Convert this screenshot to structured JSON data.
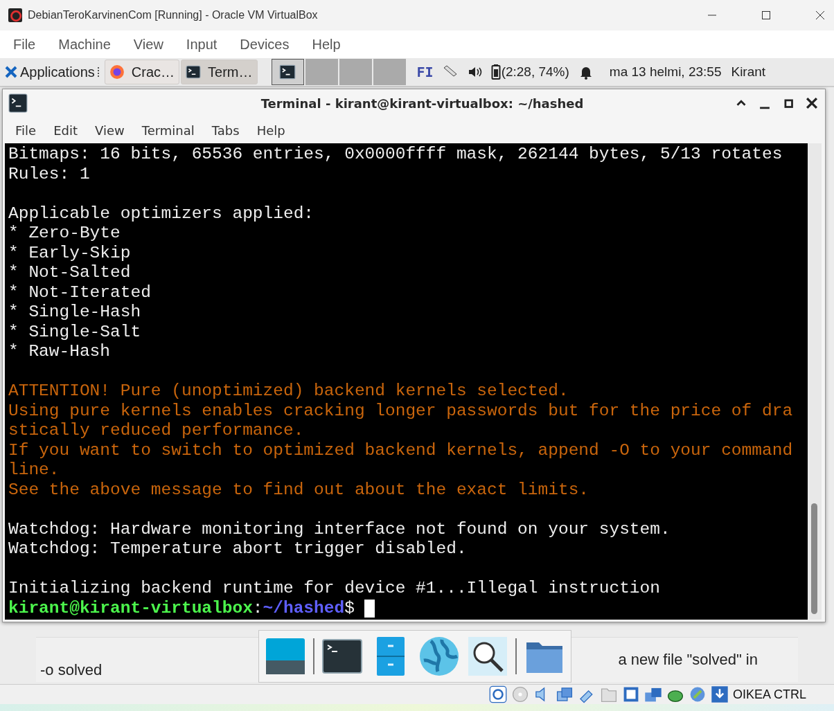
{
  "host_window": {
    "title": "DebianTeroKarvinenCom [Running] - Oracle VM VirtualBox"
  },
  "host_menu": [
    "File",
    "Machine",
    "View",
    "Input",
    "Devices",
    "Help"
  ],
  "guest_panel": {
    "applications": "Applications",
    "tasks": [
      {
        "label": "Crac…",
        "kind": "browser",
        "selected": false
      },
      {
        "label": "Term…",
        "kind": "terminal",
        "selected": true
      }
    ],
    "workspaces": [
      {
        "selected": true
      },
      {
        "selected": false
      },
      {
        "selected": false
      },
      {
        "selected": false
      }
    ],
    "keyboard_layout": "FI",
    "battery": "(2:28, 74%)",
    "clock": "ma 13 helmi, 23:55",
    "user": "Kirant"
  },
  "terminal": {
    "title": "Terminal - kirant@kirant-virtualbox: ~/hashed",
    "menu": [
      "File",
      "Edit",
      "View",
      "Terminal",
      "Tabs",
      "Help"
    ],
    "lines": [
      {
        "kind": "normal",
        "text": "Bitmaps: 16 bits, 65536 entries, 0x0000ffff mask, 262144 bytes, 5/13 rotates"
      },
      {
        "kind": "normal",
        "text": "Rules: 1"
      },
      {
        "kind": "blank"
      },
      {
        "kind": "normal",
        "text": "Applicable optimizers applied:"
      },
      {
        "kind": "normal",
        "text": "* Zero-Byte"
      },
      {
        "kind": "normal",
        "text": "* Early-Skip"
      },
      {
        "kind": "normal",
        "text": "* Not-Salted"
      },
      {
        "kind": "normal",
        "text": "* Not-Iterated"
      },
      {
        "kind": "normal",
        "text": "* Single-Hash"
      },
      {
        "kind": "normal",
        "text": "* Single-Salt"
      },
      {
        "kind": "normal",
        "text": "* Raw-Hash"
      },
      {
        "kind": "blank"
      },
      {
        "kind": "warning",
        "text": "ATTENTION! Pure (unoptimized) backend kernels selected."
      },
      {
        "kind": "warning",
        "text": "Using pure kernels enables cracking longer passwords but for the price of dra"
      },
      {
        "kind": "warning",
        "text": "stically reduced performance."
      },
      {
        "kind": "warning",
        "text": "If you want to switch to optimized backend kernels, append -O to your command"
      },
      {
        "kind": "warning",
        "text": "line."
      },
      {
        "kind": "warning",
        "text": "See the above message to find out about the exact limits."
      },
      {
        "kind": "blank"
      },
      {
        "kind": "normal",
        "text": "Watchdog: Hardware monitoring interface not found on your system."
      },
      {
        "kind": "normal",
        "text": "Watchdog: Temperature abort trigger disabled."
      },
      {
        "kind": "blank"
      },
      {
        "kind": "normal",
        "text": "Initializing backend runtime for device #1...Illegal instruction"
      },
      {
        "kind": "prompt",
        "user": "kirant@kirant-virtualbox",
        "separator": ":",
        "path": "~/hashed",
        "symbol": "$"
      }
    ]
  },
  "background_document": {
    "left_text": "-o solved",
    "right_text": "a new file \"solved\" in"
  },
  "host_status": {
    "host_key": "OIKEA CTRL"
  }
}
